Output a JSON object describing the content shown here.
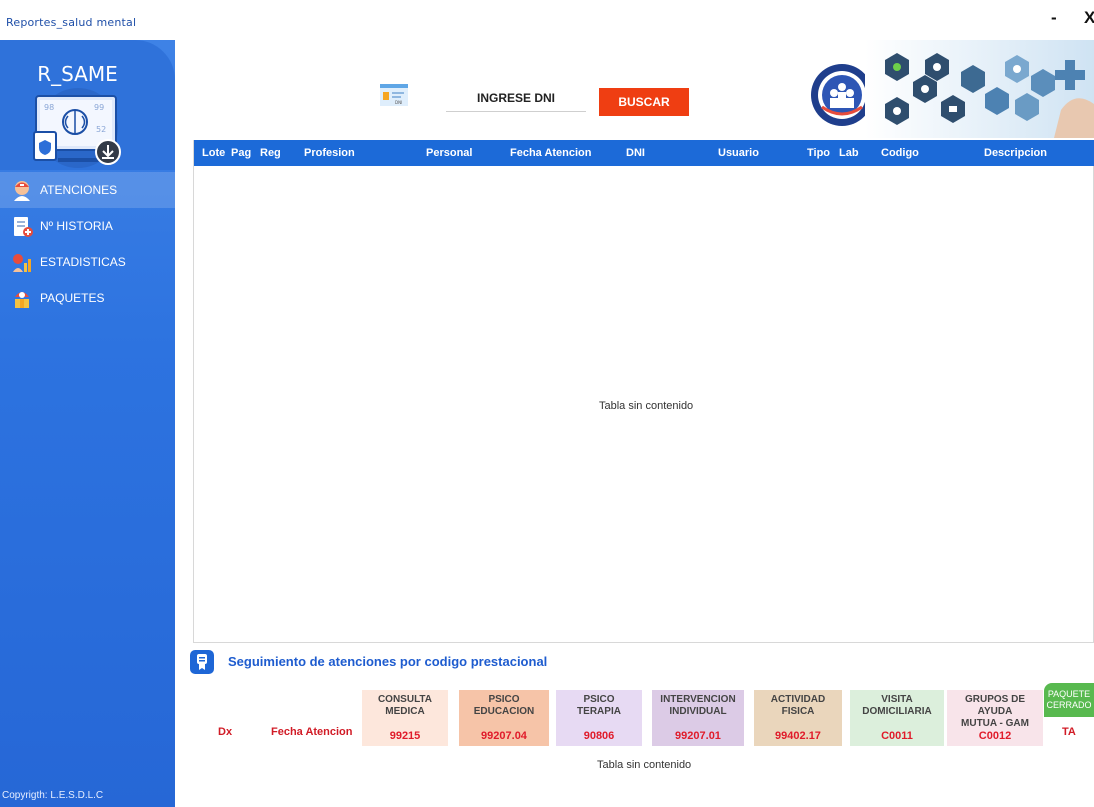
{
  "window": {
    "title": "Reportes_salud mental",
    "minimize_label": "-",
    "close_label": "X"
  },
  "sidebar": {
    "brand": "R_SAME",
    "items": [
      {
        "label": "ATENCIONES",
        "icon": "doctor-icon",
        "active": true
      },
      {
        "label": "Nº HISTORIA",
        "icon": "clipboard-icon",
        "active": false
      },
      {
        "label": "ESTADISTICAS",
        "icon": "statistics-icon",
        "active": false
      },
      {
        "label": "PAQUETES",
        "icon": "package-icon",
        "active": false
      }
    ],
    "copyright": "Copyrigth: L.E.S.D.L.C"
  },
  "search": {
    "label": "INGRESE DNI",
    "button_label": "BUSCAR",
    "card_text": "DNI"
  },
  "main_table": {
    "columns": [
      "Lote",
      "Pag",
      "Reg",
      "Profesion",
      "Personal",
      "Fecha Atencion",
      "DNI",
      "Usuario",
      "Tipo",
      "Lab",
      "Codigo",
      "Descripcion"
    ],
    "empty_text": "Tabla sin contenido"
  },
  "tracking": {
    "title": "Seguimiento de atenciones por codigo prestacional",
    "dx_label": "Dx",
    "fecha_label": "Fecha Atencion",
    "codes": [
      {
        "line1": "CONSULTA",
        "line2": "MEDICA",
        "code": "99215",
        "bg": "#fde7dc"
      },
      {
        "line1": "PSICO",
        "line2": "EDUCACION",
        "code": "99207.04",
        "bg": "#f6c4a8"
      },
      {
        "line1": "PSICO",
        "line2": "TERAPIA",
        "code": "90806",
        "bg": "#e7daf3"
      },
      {
        "line1": "INTERVENCION",
        "line2": "INDIVIDUAL",
        "code": "99207.01",
        "bg": "#dccbe6"
      },
      {
        "line1": "ACTIVIDAD",
        "line2": "FISICA",
        "code": "99402.17",
        "bg": "#ead6bc"
      },
      {
        "line1": "VISITA",
        "line2": "DOMICILIARIA",
        "code": "C0011",
        "bg": "#dcefdc"
      },
      {
        "line1": "GRUPOS DE AYUDA",
        "line2": "MUTUA  - GAM",
        "code": "C0012",
        "bg": "#f8e4ea"
      }
    ],
    "paquete_line1": "PAQUETE",
    "paquete_line2": "CERRADO",
    "ta_label": "TA",
    "empty_text": "Tabla sin contenido"
  },
  "colors": {
    "sidebar": "#2d73e0",
    "table_header": "#1c6ad8",
    "buscar_button": "#ef3e12",
    "code_text": "#e01b2a",
    "paquete": "#58b94f"
  }
}
